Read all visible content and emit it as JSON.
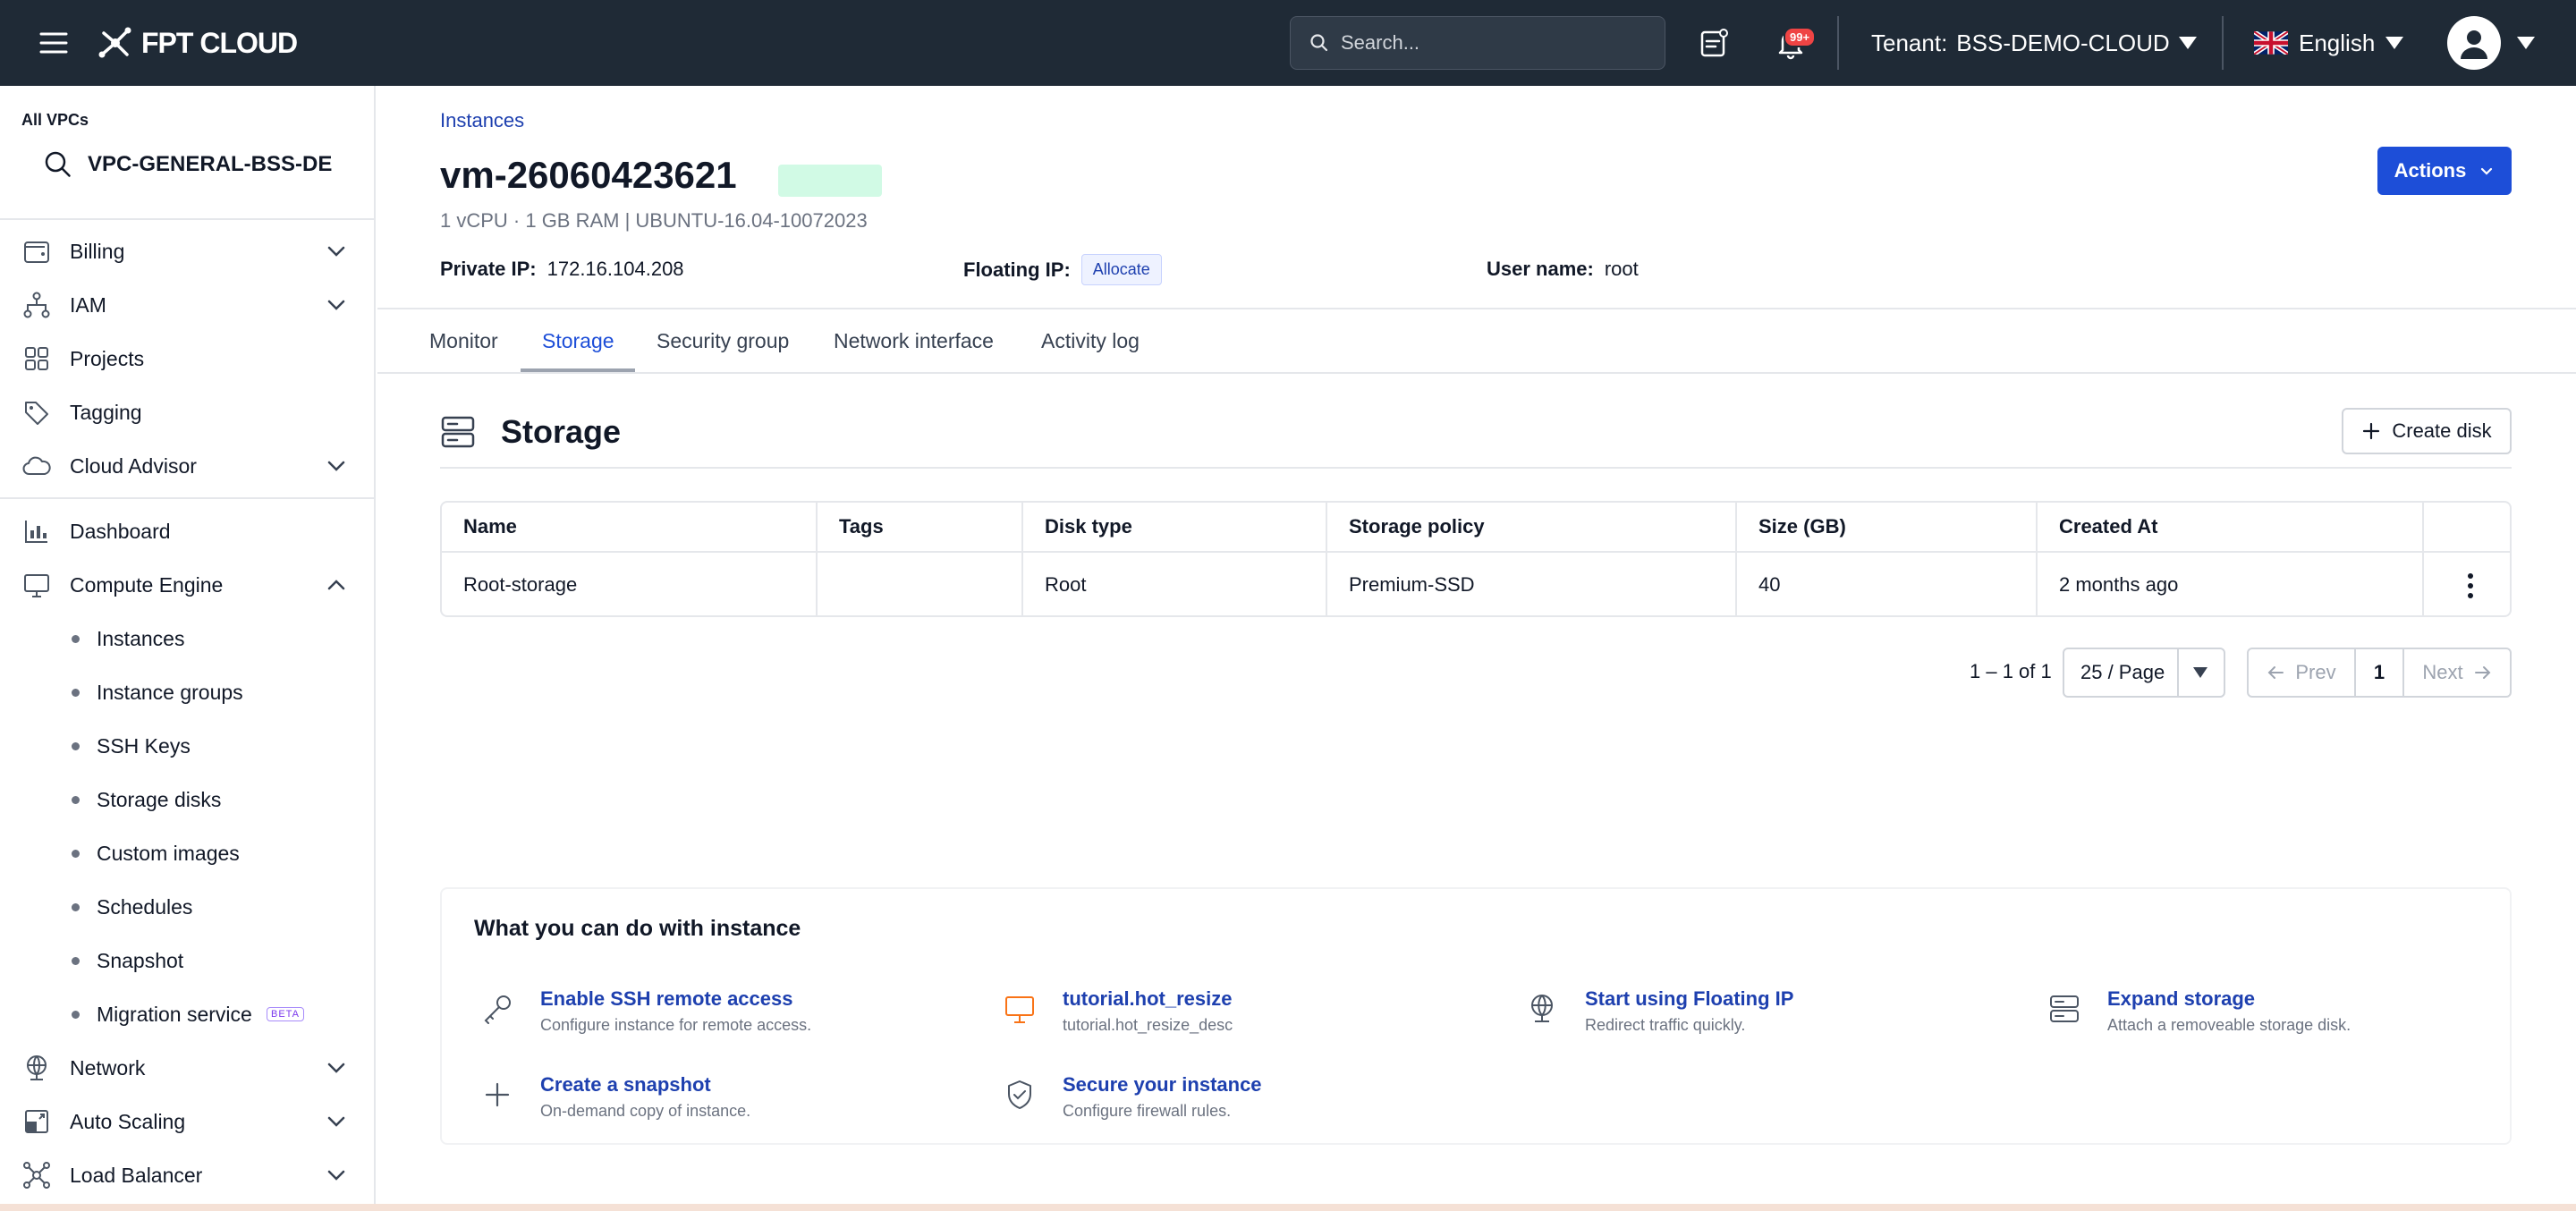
{
  "topbar": {
    "brand": "FPT CLOUD",
    "search_placeholder": "Search...",
    "notification_badge": "99+",
    "tenant_label": "Tenant:",
    "tenant_value": "BSS-DEMO-CLOUD",
    "language": "English"
  },
  "sidebar": {
    "vpc_label": "All VPCs",
    "vpc_value": "VPC-GENERAL-BSS-DE",
    "items": [
      {
        "label": "Billing",
        "icon": "wallet-icon",
        "expandable": true
      },
      {
        "label": "IAM",
        "icon": "hierarchy-icon",
        "expandable": true
      },
      {
        "label": "Projects",
        "icon": "grid-icon",
        "expandable": false
      },
      {
        "label": "Tagging",
        "icon": "tag-icon",
        "expandable": false
      },
      {
        "label": "Cloud Advisor",
        "icon": "cloud-icon",
        "expandable": true
      },
      {
        "label": "Dashboard",
        "icon": "chart-icon",
        "expandable": false
      },
      {
        "label": "Compute Engine",
        "icon": "monitor-icon",
        "expanded": true
      },
      {
        "label": "Network",
        "icon": "globe-icon",
        "expandable": true
      },
      {
        "label": "Auto Scaling",
        "icon": "scaling-icon",
        "expandable": true
      },
      {
        "label": "Load Balancer",
        "icon": "network-icon",
        "expandable": true
      }
    ],
    "compute_sub": [
      "Instances",
      "Instance groups",
      "SSH Keys",
      "Storage disks",
      "Custom images",
      "Schedules",
      "Snapshot",
      "Migration service"
    ],
    "beta_label": "BETA"
  },
  "instance": {
    "breadcrumb": "Instances",
    "name": "vm-26060423621",
    "spec": "1 vCPU · 1 GB RAM | UBUNTU-16.04-10072023",
    "private_ip_label": "Private IP:",
    "private_ip": "172.16.104.208",
    "floating_ip_label": "Floating IP:",
    "allocate_label": "Allocate",
    "username_label": "User name:",
    "username": "root",
    "actions_label": "Actions",
    "status_color": "#d1fae5"
  },
  "tabs": [
    "Monitor",
    "Storage",
    "Security group",
    "Network interface",
    "Activity log"
  ],
  "active_tab": "Storage",
  "storage": {
    "title": "Storage",
    "create_label": "Create disk",
    "columns": [
      "Name",
      "Tags",
      "Disk type",
      "Storage policy",
      "Size (GB)",
      "Created At"
    ],
    "rows": [
      {
        "name": "Root-storage",
        "tags": "",
        "disk_type": "Root",
        "policy": "Premium-SSD",
        "size": "40",
        "created": "2 months ago"
      }
    ]
  },
  "pagination": {
    "count": "1 – 1 of 1",
    "page_size": "25 / Page",
    "prev": "Prev",
    "page": "1",
    "next": "Next"
  },
  "tips": {
    "title": "What you can do with instance",
    "items": [
      {
        "title": "Enable SSH remote access",
        "desc": "Configure instance for remote access.",
        "icon": "key-icon"
      },
      {
        "title": "tutorial.hot_resize",
        "desc": "tutorial.hot_resize_desc",
        "icon": "monitor-icon"
      },
      {
        "title": "Start using Floating IP",
        "desc": "Redirect traffic quickly.",
        "icon": "globe-icon"
      },
      {
        "title": "Expand storage",
        "desc": "Attach a removeable storage disk.",
        "icon": "storage-icon"
      },
      {
        "title": "Create a snapshot",
        "desc": "On-demand copy of instance.",
        "icon": "plus-icon"
      },
      {
        "title": "Secure your instance",
        "desc": "Configure firewall rules.",
        "icon": "shield-icon"
      }
    ]
  },
  "colors": {
    "accent": "#1d4ed8",
    "topbar": "#1f2a36",
    "link": "#1e40af"
  }
}
